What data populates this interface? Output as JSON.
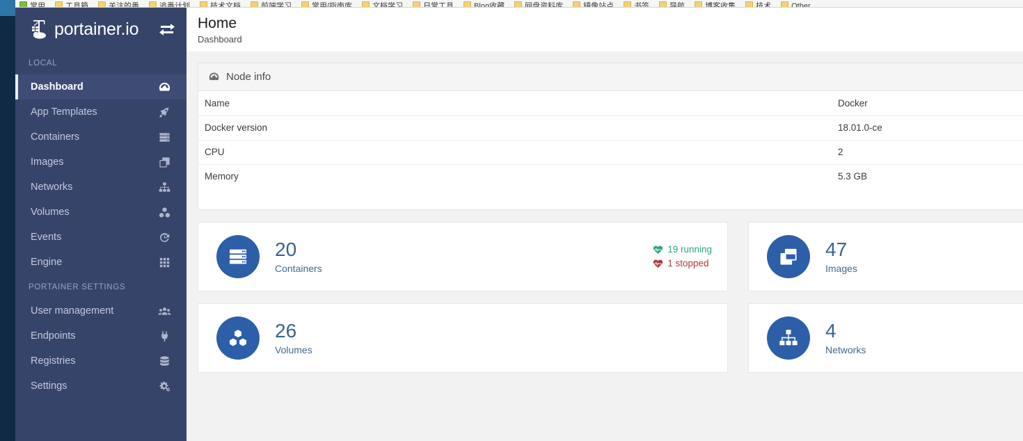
{
  "browser": {
    "bookmarks": [
      {
        "label": "常用",
        "icon": "folder-green-icon"
      },
      {
        "label": "工具箱",
        "icon": "folder-icon"
      },
      {
        "label": "关注的番",
        "icon": "folder-icon"
      },
      {
        "label": "追番计划",
        "icon": "folder-icon"
      },
      {
        "label": "技术文档",
        "icon": "folder-icon"
      },
      {
        "label": "前端学习",
        "icon": "folder-icon"
      },
      {
        "label": "常用/指南库",
        "icon": "folder-icon"
      },
      {
        "label": "文档学习",
        "icon": "folder-icon"
      },
      {
        "label": "日常工具",
        "icon": "folder-icon"
      },
      {
        "label": "Blog收藏",
        "icon": "folder-icon"
      },
      {
        "label": "网盘资料库",
        "icon": "folder-icon"
      },
      {
        "label": "镜像站点",
        "icon": "folder-icon"
      },
      {
        "label": "书签",
        "icon": "folder-icon"
      },
      {
        "label": "导航",
        "icon": "folder-icon"
      },
      {
        "label": "博客收集",
        "icon": "folder-icon"
      },
      {
        "label": "技术",
        "icon": "folder-icon"
      },
      {
        "label": "Other",
        "icon": "folder-icon"
      }
    ]
  },
  "sidebar": {
    "brand": "portainer.io",
    "brand_logo_icon": "portainer-whale-crane-logo-icon",
    "toggle_icon": "exchange-arrows-toggle-icon",
    "sections": [
      {
        "title": "LOCAL",
        "items": [
          {
            "label": "Dashboard",
            "icon": "tachometer-icon",
            "active": true
          },
          {
            "label": "App Templates",
            "icon": "rocket-icon",
            "active": false
          },
          {
            "label": "Containers",
            "icon": "server-stack-icon",
            "active": false
          },
          {
            "label": "Images",
            "icon": "clone-layers-icon",
            "active": false
          },
          {
            "label": "Networks",
            "icon": "sitemap-icon",
            "active": false
          },
          {
            "label": "Volumes",
            "icon": "cubes-icon",
            "active": false
          },
          {
            "label": "Events",
            "icon": "history-clock-icon",
            "active": false
          },
          {
            "label": "Engine",
            "icon": "grid-squares-icon",
            "active": false
          }
        ]
      },
      {
        "title": "PORTAINER SETTINGS",
        "items": [
          {
            "label": "User management",
            "icon": "users-icon",
            "active": false
          },
          {
            "label": "Endpoints",
            "icon": "plug-icon",
            "active": false
          },
          {
            "label": "Registries",
            "icon": "database-icon",
            "active": false
          },
          {
            "label": "Settings",
            "icon": "cogs-icon",
            "active": false
          }
        ]
      }
    ]
  },
  "header": {
    "title": "Home",
    "subtitle": "Dashboard"
  },
  "node_info": {
    "panel_title": "Node info",
    "panel_icon": "tachometer-icon",
    "rows": [
      {
        "key": "Name",
        "value": "Docker"
      },
      {
        "key": "Docker version",
        "value": "18.01.0-ce"
      },
      {
        "key": "CPU",
        "value": "2"
      },
      {
        "key": "Memory",
        "value": "5.3 GB"
      }
    ]
  },
  "stats": {
    "containers": {
      "count": "20",
      "label": "Containers",
      "icon": "server-stack-icon",
      "running": "19 running",
      "stopped": "1 stopped",
      "running_icon": "heartbeat-green-icon",
      "stopped_icon": "heartbeat-red-icon"
    },
    "images": {
      "count": "47",
      "label": "Images",
      "icon": "clone-layers-icon"
    },
    "volumes": {
      "count": "26",
      "label": "Volumes",
      "icon": "cubes-icon"
    },
    "networks": {
      "count": "4",
      "label": "Networks",
      "icon": "sitemap-icon"
    }
  },
  "colors": {
    "sidebar_bg": "#37446a",
    "sidebar_active_bg": "#3e4c75",
    "accent_blue": "#2c5fa8",
    "stat_text_blue": "#396392",
    "running_green": "#2aa87e",
    "stopped_red": "#ae3b3b",
    "page_bg": "#f2f2f2"
  }
}
